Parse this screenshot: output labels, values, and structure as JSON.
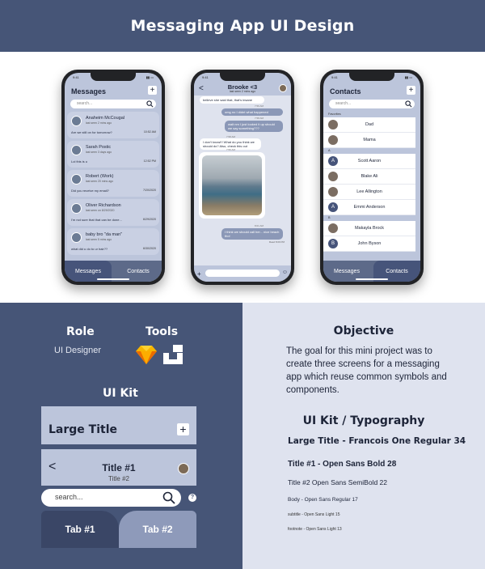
{
  "header": {
    "title": "Messaging App UI Design"
  },
  "colors": {
    "navy": "#465577",
    "lightBlue": "#bcc5db",
    "pale": "#dfe3ef",
    "tabDark": "#3a4666",
    "tabLight": "#8e9aba"
  },
  "phone1": {
    "time": "9:41",
    "title": "Messages",
    "search_placeholder": "search...",
    "messages": [
      {
        "name": "Anaheim McCougal",
        "sub": "last seen 2 mins ago",
        "preview": "Are we still on for tomorrow?",
        "time": "10:52 AM"
      },
      {
        "name": "Sarah Postic",
        "sub": "last seen 3 days ago",
        "preview": "Lol this is u",
        "time": "12:52 PM"
      },
      {
        "name": "Robert (Work)",
        "sub": "last seen 20 mins ago",
        "preview": "Did you receive my email?",
        "time": "7/20/2020"
      },
      {
        "name": "Oliver Richardson",
        "sub": "last seen on 8/29/2020",
        "preview": "I'm not sure that that can be done...",
        "time": "6/29/2020"
      },
      {
        "name": "baby bro \"da man\"",
        "sub": "last seen 5 mins ago",
        "preview": "what did u do to ur hair??",
        "time": "6/30/2020"
      }
    ],
    "tabs": {
      "left": "Messages",
      "right": "Contacts"
    }
  },
  "phone2": {
    "time": "9:41",
    "title": "Brooke <3",
    "sub": "last seen 2 mins ago",
    "bubbles": [
      {
        "text": "believe she said that, that's insane",
        "dir": "in"
      },
      {
        "text": "omg no I didnt what happened",
        "dir": "out"
      },
      {
        "text": "wait nm I just looked it up should we say something???",
        "dir": "out"
      },
      {
        "text": "I don't know!!! What do you think we should do? Also, check this out",
        "dir": "in"
      },
      {
        "text": "I think we should call her... nice beach tho!",
        "dir": "out"
      }
    ],
    "timestamps": [
      "7:56 AM",
      "7:58 AM",
      "7:58 AM",
      "7:59 AM",
      "8:01 AM"
    ],
    "read": "Read 8:09 PM"
  },
  "phone3": {
    "time": "9:41",
    "title": "Contacts",
    "search_placeholder": "search...",
    "sections": [
      {
        "header": "Favorites",
        "contacts": [
          {
            "name": "Dad",
            "letter": ""
          },
          {
            "name": "Mama",
            "letter": ""
          }
        ]
      },
      {
        "header": "A",
        "contacts": [
          {
            "name": "Scott Aaron",
            "letter": "A"
          },
          {
            "name": "Blake Ali",
            "letter": ""
          },
          {
            "name": "Lee Allington",
            "letter": ""
          },
          {
            "name": "Emmi Anderson",
            "letter": "A"
          }
        ]
      },
      {
        "header": "B",
        "contacts": [
          {
            "name": "Makayla Brock",
            "letter": ""
          },
          {
            "name": "John Byson",
            "letter": "B"
          }
        ]
      }
    ],
    "tabs": {
      "left": "Messages",
      "right": "Contacts"
    }
  },
  "role": {
    "title": "Role",
    "value": "UI Designer"
  },
  "tools": {
    "title": "Tools",
    "icons": [
      "sketch-icon",
      "craft-icon"
    ]
  },
  "uikit": {
    "title": "UI Kit",
    "large_title": "Large Title",
    "title1": "Title #1",
    "title2": "Title #2",
    "search_placeholder": "search...",
    "info": "?",
    "tab1": "Tab #1",
    "tab2": "Tab #2"
  },
  "objective": {
    "title": "Objective",
    "text": "The goal for this mini project was to create three screens for a messaging app which reuse common symbols and components."
  },
  "typography": {
    "title": "UI Kit / Typography",
    "items": [
      "Large Title - Francois One Regular 34",
      "Title #1 - Open Sans Bold 28",
      "Title #2 Open Sans SemiBold 22",
      "Body - Open Sans Regular 17",
      "subtitle - Open Sans Light 15",
      "footnote - Open Sans Light 13"
    ]
  }
}
